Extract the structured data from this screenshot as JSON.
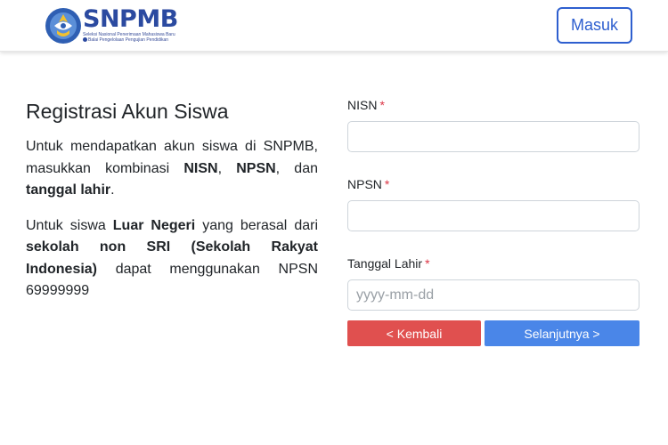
{
  "navbar": {
    "logo": {
      "name": "SNPMB",
      "tagline": "Seleksi Nasional Penerimaan Mahasiswa Baru",
      "subtagline": "Balai Pengelolaan Pengujian Pendidikan"
    },
    "login_button": "Masuk"
  },
  "intro": {
    "title": "Registrasi Akun Siswa",
    "p1": {
      "lead": "Untuk mendapatkan akun siswa di SNPMB, masukkan kombinasi ",
      "nisn": "NISN",
      "sep1": ", ",
      "npsn": "NPSN",
      "sep2": ", dan ",
      "dob": "tanggal lahir",
      "end": "."
    },
    "p2": {
      "lead": "Untuk siswa ",
      "luar_negeri": "Luar Negeri",
      "mid": " yang berasal dari ",
      "sekolah": "sekolah non SRI (Sekolah Rakyat Indonesia)",
      "tail": " dapat menggunakan NPSN 69999999"
    }
  },
  "form": {
    "nisn": {
      "label": "NISN",
      "required_mark": "*",
      "value": "",
      "placeholder": ""
    },
    "npsn": {
      "label": "NPSN",
      "required_mark": "*",
      "value": "",
      "placeholder": ""
    },
    "dob": {
      "label": "Tanggal Lahir",
      "required_mark": "*",
      "value": "",
      "placeholder": "yyyy-mm-dd"
    }
  },
  "buttons": {
    "back": "< Kembali",
    "next": "Selanjutnya >"
  },
  "colors": {
    "brand_blue": "#2e5fcf",
    "back_red": "#e0504f",
    "next_blue": "#4a86e8",
    "required_red": "#dc3545"
  }
}
